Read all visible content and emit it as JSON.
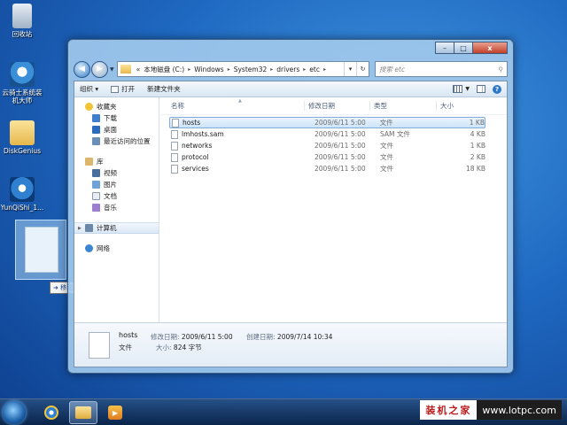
{
  "desktop": {
    "icons": [
      {
        "label": "回收站"
      },
      {
        "label": "云骑士系统装机大师"
      },
      {
        "label": "DiskGenius"
      },
      {
        "label": "YunQiShi_1..."
      }
    ],
    "drag_tooltip": {
      "action": "移动到",
      "target": "桌面"
    }
  },
  "window": {
    "controls": {
      "minimize": "–",
      "maximize": "□",
      "close": "x"
    },
    "address": {
      "prefix": "«",
      "segments": [
        "本地磁盘 (C:)",
        "Windows",
        "System32",
        "drivers",
        "etc"
      ]
    },
    "search_placeholder": "搜索 etc",
    "toolbar": {
      "organize": "组织 ▾",
      "open": "打开",
      "new_folder": "新建文件夹"
    },
    "nav_pane": {
      "favorites": {
        "label": "收藏夹",
        "items": [
          "下载",
          "桌面",
          "最近访问的位置"
        ]
      },
      "libraries": {
        "label": "库",
        "items": [
          "视频",
          "图片",
          "文档",
          "音乐"
        ]
      },
      "computer": "计算机",
      "network": "网络"
    },
    "columns": {
      "name": "名称",
      "date": "修改日期",
      "type": "类型",
      "size": "大小"
    },
    "files": [
      {
        "name": "hosts",
        "date": "2009/6/11 5:00",
        "type": "文件",
        "size": "1 KB"
      },
      {
        "name": "lmhosts.sam",
        "date": "2009/6/11 5:00",
        "type": "SAM 文件",
        "size": "4 KB"
      },
      {
        "name": "networks",
        "date": "2009/6/11 5:00",
        "type": "文件",
        "size": "1 KB"
      },
      {
        "name": "protocol",
        "date": "2009/6/11 5:00",
        "type": "文件",
        "size": "2 KB"
      },
      {
        "name": "services",
        "date": "2009/6/11 5:00",
        "type": "文件",
        "size": "18 KB"
      }
    ],
    "details": {
      "name": "hosts",
      "type": "文件",
      "modified_label": "修改日期:",
      "modified": "2009/6/11 5:00",
      "size_label": "大小:",
      "size": "824 字节",
      "created_label": "创建日期:",
      "created": "2009/7/14 10:34"
    }
  },
  "taskbar": {
    "watermark": {
      "left": "装机之家",
      "right": "www.lotpc.com"
    }
  }
}
